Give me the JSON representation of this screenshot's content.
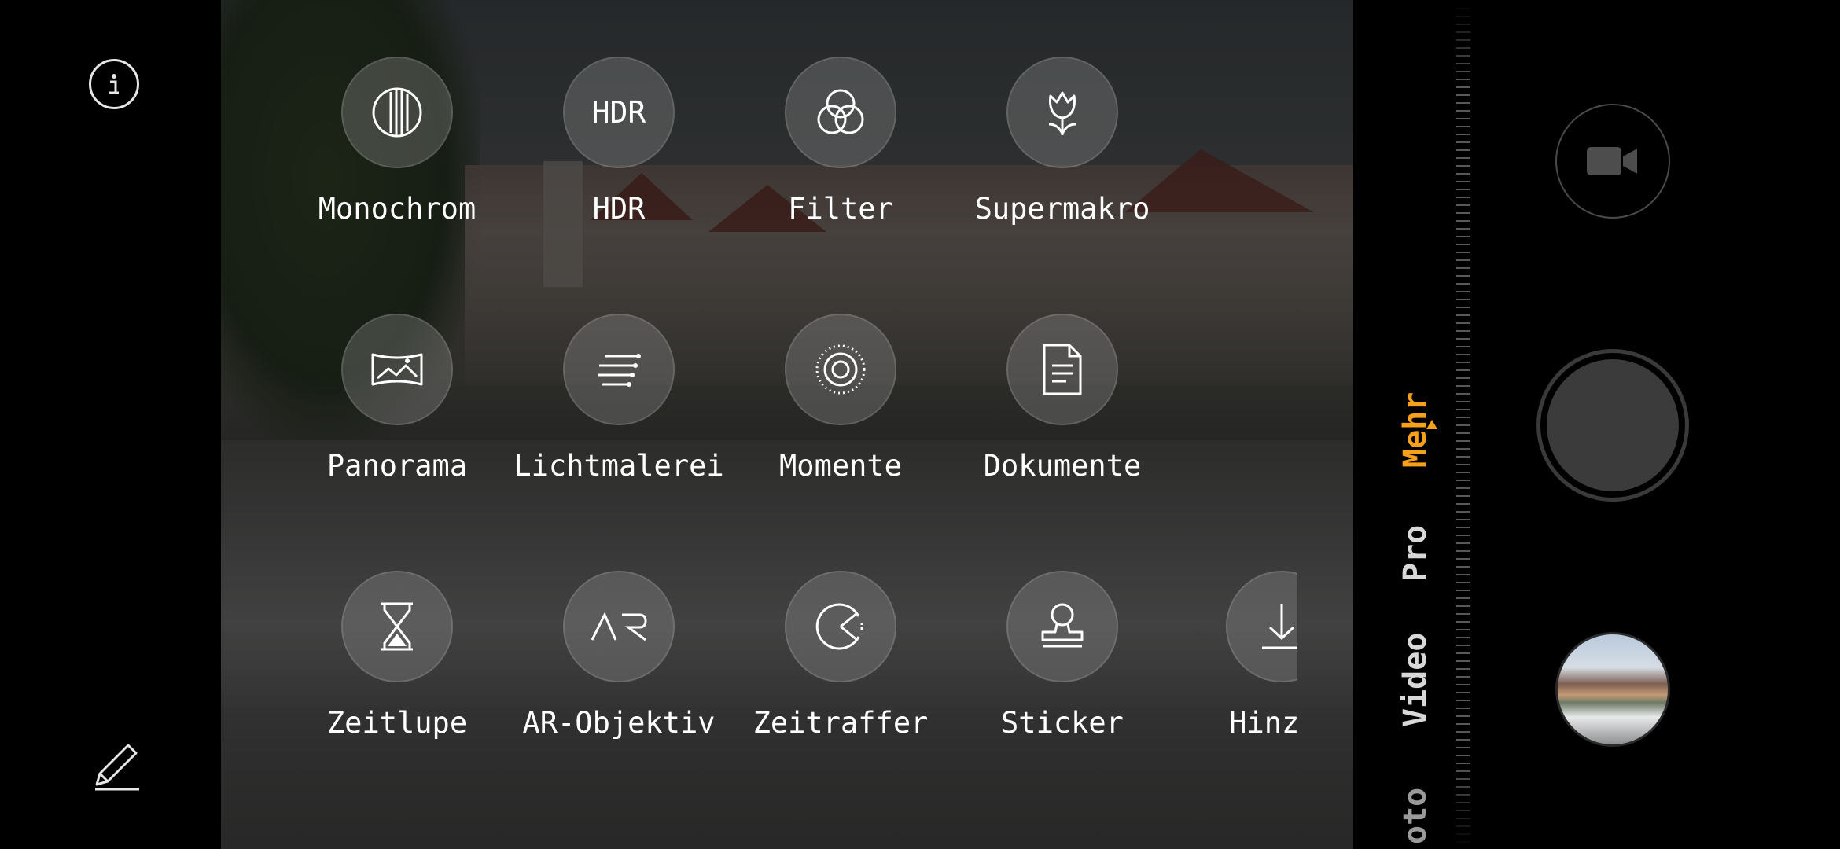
{
  "colors": {
    "accent": "#f7a11a",
    "background": "#000000",
    "mode_button_fill": "rgba(150,150,150,0.33)"
  },
  "left_bar": {
    "info_icon": "info-icon",
    "edit_icon": "pencil-icon"
  },
  "modes": [
    {
      "label": "Monochrom",
      "icon": "monochrome-icon"
    },
    {
      "label": "HDR",
      "icon": "hdr-icon",
      "icon_text": "HDR"
    },
    {
      "label": "Filter",
      "icon": "filter-icon"
    },
    {
      "label": "Supermakro",
      "icon": "tulip-icon"
    },
    {
      "label": "Panorama",
      "icon": "panorama-icon"
    },
    {
      "label": "Lichtmalerei",
      "icon": "light-painting-icon"
    },
    {
      "label": "Momente",
      "icon": "moments-icon"
    },
    {
      "label": "Dokumente",
      "icon": "document-icon"
    },
    {
      "label": "Zeitlupe",
      "icon": "hourglass-icon"
    },
    {
      "label": "AR-Objektiv",
      "icon": "ar-icon"
    },
    {
      "label": "Zeitraffer",
      "icon": "timelapse-icon"
    },
    {
      "label": "Sticker",
      "icon": "stamp-icon"
    },
    {
      "label": "Hinzuf",
      "icon": "download-icon"
    }
  ],
  "camera_modes": {
    "tabs": [
      "Mehr",
      "Pro",
      "Video",
      "oto"
    ],
    "active": "Mehr"
  },
  "controls": {
    "video_icon": "video-camera-icon",
    "shutter": "shutter-button",
    "gallery": "gallery-thumbnail"
  }
}
